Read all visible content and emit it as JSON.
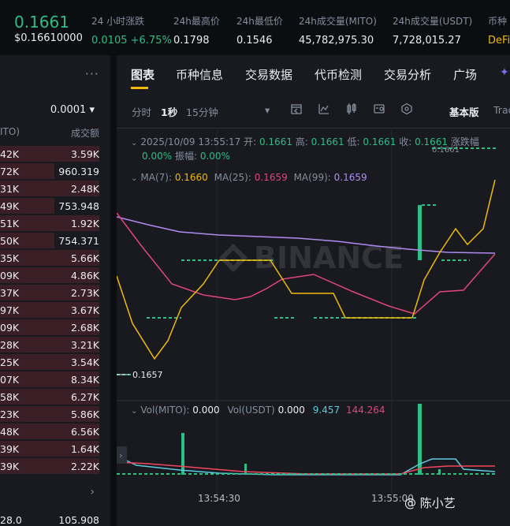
{
  "ticker": {
    "price": "0.1661",
    "price_usd": "$0.16610000",
    "stats": [
      {
        "label": "24 小时涨跌",
        "value": "0.0105 +6.75%",
        "color": "green"
      },
      {
        "label": "24h最高价",
        "value": "0.1798",
        "color": "normal"
      },
      {
        "label": "24h最低价",
        "value": "0.1546",
        "color": "normal"
      },
      {
        "label": "24h成交量(MITO)",
        "value": "45,782,975.30",
        "color": "normal"
      },
      {
        "label": "24h成交量(USDT)",
        "value": "7,728,015.27",
        "color": "normal"
      },
      {
        "label": "币种",
        "value": "DeFi",
        "color": "yellow"
      }
    ]
  },
  "orderbook": {
    "more": "···",
    "precision": "0.0001 ▾",
    "col_amount": "ITO)",
    "col_total": "成交额",
    "rows": [
      {
        "a": "42K",
        "b": "3.59K",
        "bar": 100
      },
      {
        "a": "72K",
        "b": "960.319",
        "bar": 55
      },
      {
        "a": "31K",
        "b": "2.48K",
        "bar": 100
      },
      {
        "a": "49K",
        "b": "753.948",
        "bar": 55
      },
      {
        "a": "51K",
        "b": "1.92K",
        "bar": 100
      },
      {
        "a": "50K",
        "b": "754.371",
        "bar": 55
      },
      {
        "a": "35K",
        "b": "5.66K",
        "bar": 100
      },
      {
        "a": "09K",
        "b": "4.86K",
        "bar": 100
      },
      {
        "a": "37K",
        "b": "2.73K",
        "bar": 100
      },
      {
        "a": "97K",
        "b": "3.67K",
        "bar": 100
      },
      {
        "a": "09K",
        "b": "2.68K",
        "bar": 100
      },
      {
        "a": "28K",
        "b": "3.21K",
        "bar": 100
      },
      {
        "a": "25K",
        "b": "3.54K",
        "bar": 100
      },
      {
        "a": "07K",
        "b": "8.34K",
        "bar": 100
      },
      {
        "a": "58K",
        "b": "6.27K",
        "bar": 100
      },
      {
        "a": "23K",
        "b": "5.86K",
        "bar": 100
      },
      {
        "a": "48K",
        "b": "6.56K",
        "bar": 100
      },
      {
        "a": "39K",
        "b": "1.64K",
        "bar": 100
      },
      {
        "a": "39K",
        "b": "2.22K",
        "bar": 100
      }
    ],
    "arrow": "›",
    "footer_left": "28.0",
    "footer_right": "105.908"
  },
  "tabs": [
    "图表",
    "币种信息",
    "交易数据",
    "代币检测",
    "交易分析",
    "广场"
  ],
  "toolbar": {
    "time_label": "分时",
    "interval_active": "1秒",
    "interval_other": "15分钟",
    "dropdown": "▾",
    "icons": [
      "indicator-icon",
      "draw-icon",
      "candle-icon",
      "compare-icon",
      "settings-hex-icon"
    ],
    "basic": "基本版",
    "trading": "Trad"
  },
  "chart_info": {
    "date": "2025/10/09 13:55:17",
    "open_label": "开:",
    "open": "0.1661",
    "high_label": "高:",
    "high": "0.1661",
    "low_label": "低:",
    "low": "0.1661",
    "close_label": "收:",
    "close": "0.1661",
    "change_label": "涨跌幅",
    "change": "0.00%",
    "amp_label": "振幅:",
    "amp": "0.00%",
    "ma7_label": "MA(7):",
    "ma7": "0.1660",
    "ma25_label": "MA(25):",
    "ma25": "0.1659",
    "ma99_label": "MA(99):",
    "ma99": "0.1659",
    "price_tag_top": "0.1661",
    "price_tag_low": "0.1657",
    "watermark": "BINANCE"
  },
  "volume_info": {
    "vol_mito_label": "Vol(MITO):",
    "vol_mito": "0.000",
    "vol_usdt_label": "Vol(USDT)",
    "vol_usdt": "0.000",
    "ma1": "9.457",
    "ma2": "144.264"
  },
  "time_axis": [
    "13:54:30",
    "13:55:00"
  ],
  "watermark_user": "@ 陈小艺",
  "colors": {
    "up": "#2ebd85",
    "down": "#f6465d",
    "ma7": "#f0b90b",
    "ma25": "#e0457b",
    "ma99": "#b18bf2",
    "vol_ma": "#5ec9e0"
  }
}
